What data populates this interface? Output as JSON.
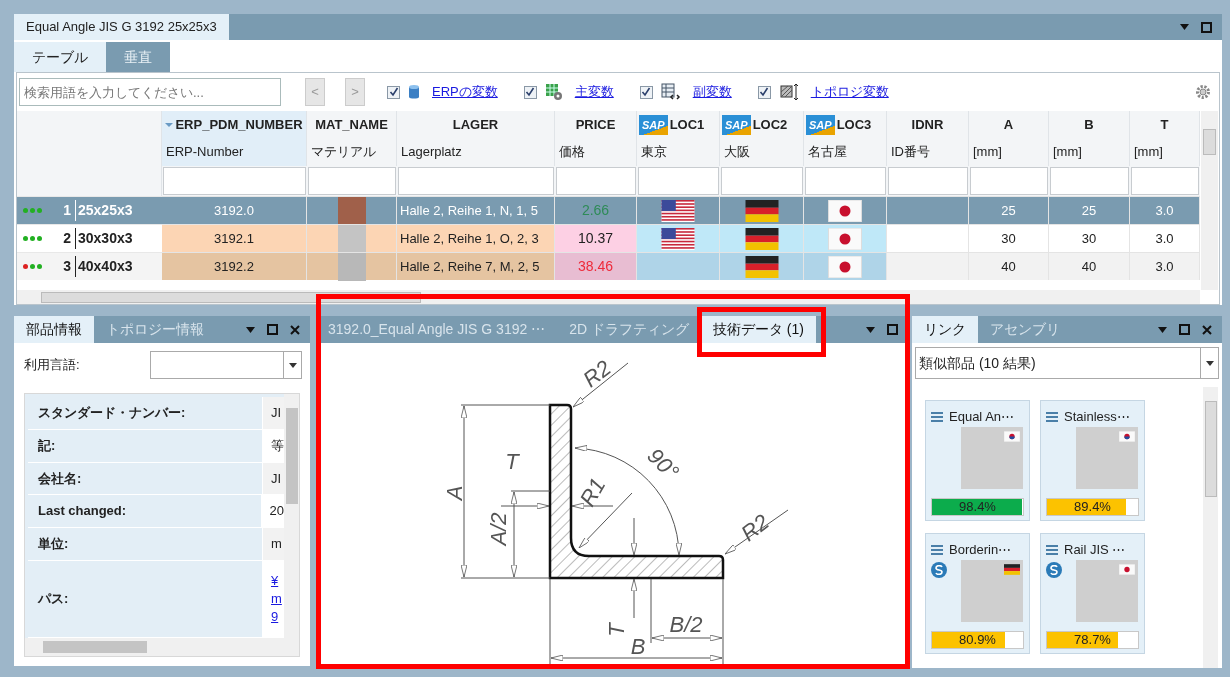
{
  "window": {
    "title": "Equal Angle JIS G 3192 25x25x3"
  },
  "view_tabs": [
    {
      "label": "テーブル",
      "selected": true
    },
    {
      "label": "垂直",
      "selected": false
    }
  ],
  "toolbar": {
    "search": {
      "placeholder": "検索用語を入力してください..."
    },
    "prev": "<",
    "next": ">",
    "filters": [
      {
        "kind": "erp",
        "label": "ERPの変数",
        "checked": true
      },
      {
        "kind": "main",
        "label": "主変数",
        "checked": true
      },
      {
        "kind": "sub",
        "label": "副変数",
        "checked": true
      },
      {
        "kind": "topology",
        "label": "トポロジ変数",
        "checked": true
      }
    ]
  },
  "table": {
    "columns": [
      {
        "title": "ERP_PDM_NUMBER",
        "subtitle": "ERP-Number",
        "sorted": true
      },
      {
        "title": "MAT_NAME",
        "subtitle": "マテリアル",
        "sorted": false
      },
      {
        "title": "LAGER",
        "subtitle": "Lagerplatz",
        "sorted": false
      },
      {
        "title": "PRICE",
        "subtitle": "価格",
        "sorted": false
      },
      {
        "logo": "SAP",
        "title": "LOC1",
        "subtitle": "東京",
        "sorted": false
      },
      {
        "logo": "SAP",
        "title": "LOC2",
        "subtitle": "大阪",
        "sorted": false
      },
      {
        "logo": "SAP",
        "title": "LOC3",
        "subtitle": "名古屋",
        "sorted": false
      },
      {
        "title": "IDNR",
        "subtitle": "ID番号",
        "sorted": false
      },
      {
        "title": "A",
        "subtitle": "[mm]",
        "sorted": false
      },
      {
        "title": "B",
        "subtitle": "[mm]",
        "sorted": false
      },
      {
        "title": "T",
        "subtitle": "[mm]",
        "sorted": false
      }
    ],
    "rows": [
      {
        "selected": true,
        "status": [
          {
            "color": "#22b022"
          },
          {
            "color": "#22b022"
          },
          {
            "color": "#22b022"
          }
        ],
        "number": "1",
        "name": "25x25x3",
        "cells": [
          {
            "text": "3192.0"
          },
          {
            "color": "#a0604a"
          },
          {
            "text": "Halle 2, Reihe 1, N, 1, 5"
          },
          {
            "text": "2.66",
            "color": "#2e8b57"
          },
          {
            "kind": "us"
          },
          {
            "kind": "de"
          },
          {
            "kind": "jp"
          },
          {},
          {
            "text": "25"
          },
          {
            "text": "25"
          },
          {
            "text": "3.0"
          }
        ]
      },
      {
        "selected": false,
        "status": [
          {
            "color": "#22b022"
          },
          {
            "color": "#22b022"
          },
          {
            "color": "#22b022"
          }
        ],
        "number": "2",
        "name": "30x30x3",
        "cells": [
          {
            "text": "3192.1"
          },
          {
            "color": "#c4c4c4"
          },
          {
            "text": "Halle 2, Reihe 1, O, 2, 3"
          },
          {
            "text": "10.37",
            "color": "#222222"
          },
          {
            "kind": "us"
          },
          {
            "kind": "de"
          },
          {
            "kind": "jp"
          },
          {},
          {
            "text": "30"
          },
          {
            "text": "30"
          },
          {
            "text": "3.0"
          }
        ]
      },
      {
        "selected": false,
        "status": [
          {
            "color": "#dd2222"
          },
          {
            "color": "#22b022"
          },
          {
            "color": "#22b022"
          }
        ],
        "number": "3",
        "name": "40x40x3",
        "cells": [
          {
            "text": "3192.2"
          },
          {
            "color": "#b8b8b8"
          },
          {
            "text": "Halle 2, Reihe 7, M, 2, 5"
          },
          {
            "text": "38.46",
            "color": "#ee2a3a"
          },
          {
            "kind": "empty"
          },
          {
            "kind": "de"
          },
          {
            "kind": "jp"
          },
          {},
          {
            "text": "40"
          },
          {
            "text": "40"
          },
          {
            "text": "3.0"
          }
        ]
      }
    ]
  },
  "part_info": {
    "tabs": [
      {
        "label": "部品情報",
        "selected": true
      },
      {
        "label": "トポロジー情報",
        "selected": false
      }
    ],
    "language_label": "利用言語:",
    "properties": [
      {
        "kind": "text",
        "label": "スタンダード・ナンバー:",
        "value": "JI"
      },
      {
        "kind": "text",
        "label": "記:",
        "value": "等"
      },
      {
        "kind": "text",
        "label": "会社名:",
        "value": "JI"
      },
      {
        "kind": "text",
        "label": "Last changed:",
        "value": "20"
      },
      {
        "kind": "text",
        "label": "単位:",
        "value": "m"
      },
      {
        "kind": "link",
        "label": "パス:",
        "lines": [
          "¥",
          "m",
          "9"
        ]
      }
    ]
  },
  "viewer": {
    "tabs": [
      {
        "label": "3192.0_Equal Angle JIS G 3192 ⋯",
        "selected": false
      },
      {
        "label": "2D ドラフティング",
        "selected": false
      },
      {
        "label": "技術データ (1)",
        "selected": true
      }
    ],
    "drawing_labels": [
      "R2",
      "T",
      "90°",
      "A",
      "A/2",
      "R1",
      "R2",
      "B/2",
      "T",
      "B"
    ]
  },
  "links": {
    "tabs": [
      {
        "label": "リンク",
        "selected": true
      },
      {
        "label": "アセンブリ",
        "selected": false
      }
    ],
    "dropdown": "類似部品 (10 結果)",
    "cards": [
      {
        "title": "Equal An⋯",
        "flag": {
          "kind": "kr"
        },
        "standard_badge": false,
        "level": 0.984,
        "color": "#0cac4c",
        "percent": "98.4%"
      },
      {
        "title": "Stainless⋯",
        "flag": {
          "kind": "kr"
        },
        "standard_badge": false,
        "level": 0.87,
        "color": "#fcc200",
        "percent": "89.4%"
      },
      {
        "title": "Borderin⋯",
        "flag": {
          "kind": "de"
        },
        "standard_badge": true,
        "level": 0.8,
        "color": "#fcc200",
        "percent": "80.9%"
      },
      {
        "title": "Rail JIS ⋯",
        "flag": {
          "kind": "jp"
        },
        "standard_badge": true,
        "level": 0.78,
        "color": "#fcc200",
        "percent": "78.7%"
      }
    ]
  }
}
